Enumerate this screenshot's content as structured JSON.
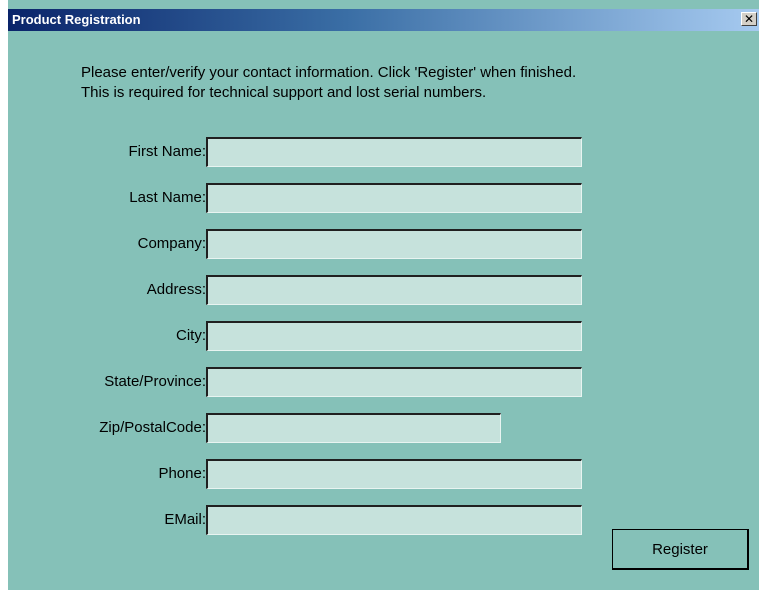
{
  "window": {
    "title": "Product Registration",
    "close_glyph": "✕",
    "close_icon": "close-icon"
  },
  "intro": {
    "line1": "Please enter/verify your contact information.  Click 'Register' when finished.",
    "line2": "This is required for technical support and lost serial numbers."
  },
  "fields": [
    {
      "label": "First Name:",
      "value": "",
      "placeholder": ""
    },
    {
      "label": "Last Name:",
      "value": "",
      "placeholder": ""
    },
    {
      "label": "Company:",
      "value": "",
      "placeholder": ""
    },
    {
      "label": "Address:",
      "value": "",
      "placeholder": ""
    },
    {
      "label": "City:",
      "value": "",
      "placeholder": ""
    },
    {
      "label": "State/Province:",
      "value": "",
      "placeholder": ""
    },
    {
      "label": "Zip/PostalCode:",
      "value": "",
      "placeholder": ""
    },
    {
      "label": "Phone:",
      "value": "",
      "placeholder": ""
    },
    {
      "label": "EMail:",
      "value": "",
      "placeholder": ""
    }
  ],
  "actions": {
    "register_label": "Register"
  },
  "colors": {
    "dialog_background": "#85c1b8",
    "input_background": "#c6e2dc",
    "titlebar_start": "#0a246a",
    "titlebar_end": "#a6caf0"
  }
}
